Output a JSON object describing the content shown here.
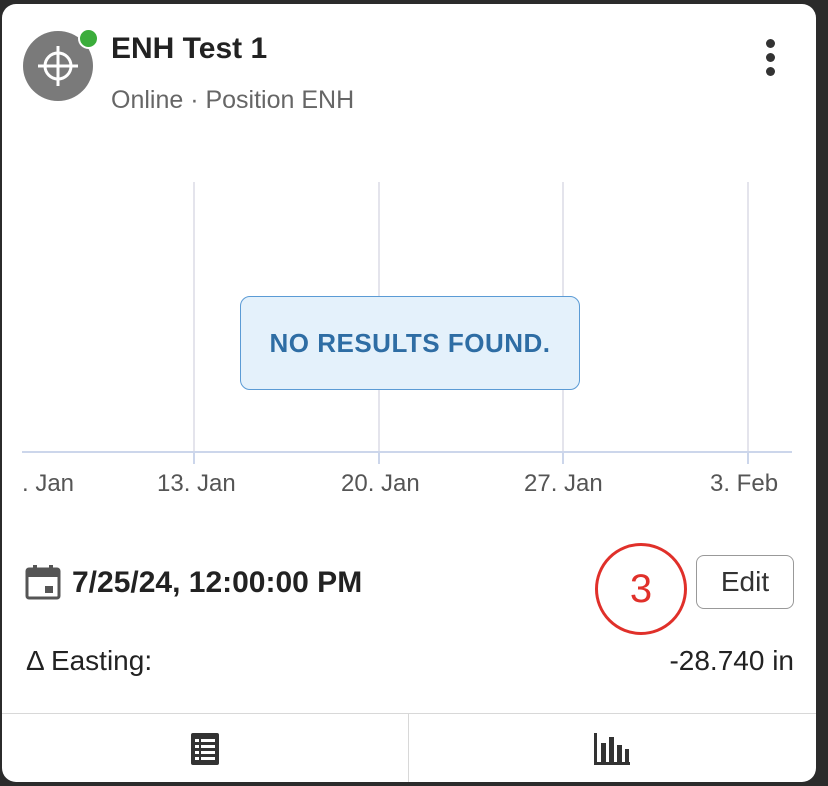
{
  "device": {
    "title": "ENH Test 1",
    "subtitle": "Online · Position ENH",
    "status": "online",
    "status_color": "#3bad3b",
    "icon": "crosshair-icon",
    "menu_icon": "more-vertical-icon"
  },
  "chart": {
    "message": "NO RESULTS FOUND.",
    "x_ticks": [
      ". Jan",
      "13. Jan",
      "20. Jan",
      "27. Jan",
      "3. Feb"
    ]
  },
  "chart_data": {
    "type": "line",
    "categories": [
      ". Jan",
      "13. Jan",
      "20. Jan",
      "27. Jan",
      "3. Feb"
    ],
    "series": [],
    "annotation": "NO RESULTS FOUND."
  },
  "timestamp": {
    "icon": "calendar-icon",
    "value": "7/25/24, 12:00:00 PM"
  },
  "step_badge": "3",
  "edit_label": "Edit",
  "metric": {
    "label": "Δ Easting:",
    "value": "-28.740 in"
  },
  "footer": {
    "tabs": [
      {
        "icon": "list-icon"
      },
      {
        "icon": "bar-chart-icon"
      }
    ]
  },
  "colors": {
    "accent": "#2e6da4",
    "badge": "#e0302a"
  }
}
